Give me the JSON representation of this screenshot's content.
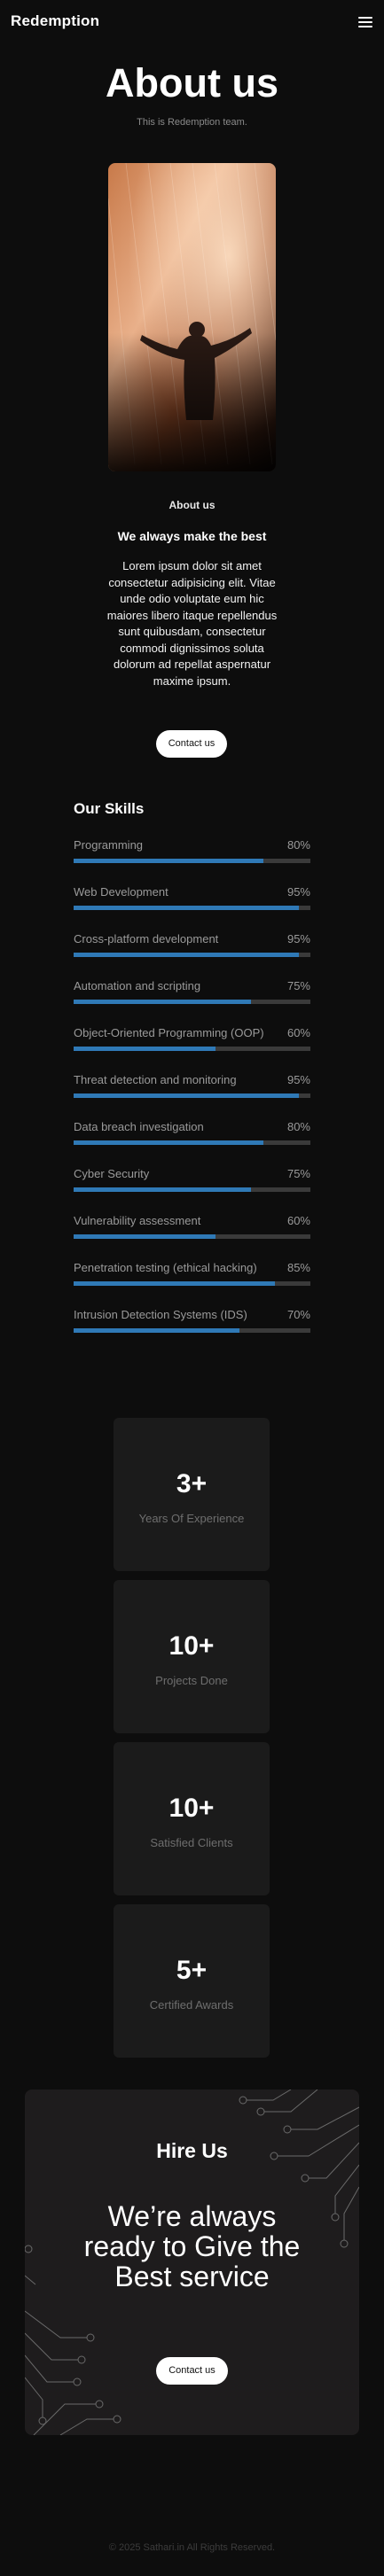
{
  "header": {
    "brand": "Redemption",
    "menu_icon": "hamburger-menu-icon"
  },
  "hero": {
    "title": "About us",
    "subtitle": "This is Redemption team."
  },
  "about": {
    "label": "About us",
    "heading": "We always make the best",
    "body": "Lorem ipsum dolor sit amet consectetur adipisicing elit. Vitae unde odio voluptate eum hic maiores libero itaque repellendus sunt quibusdam, consectetur commodi dignissimos soluta dolorum ad repellat aspernatur maxime ipsum.",
    "button": "Contact us"
  },
  "skills": {
    "title": "Our Skills",
    "bar_color": "#2f79b6",
    "items": [
      {
        "name": "Programming",
        "percent": "80%",
        "value": 80
      },
      {
        "name": "Web Development",
        "percent": "95%",
        "value": 95
      },
      {
        "name": "Cross-platform development",
        "percent": "95%",
        "value": 95
      },
      {
        "name": "Automation and scripting",
        "percent": "75%",
        "value": 75
      },
      {
        "name": "Object-Oriented Programming (OOP)",
        "percent": "60%",
        "value": 60
      },
      {
        "name": "Threat detection and monitoring",
        "percent": "95%",
        "value": 95
      },
      {
        "name": "Data breach investigation",
        "percent": "80%",
        "value": 80
      },
      {
        "name": "Cyber Security",
        "percent": "75%",
        "value": 75
      },
      {
        "name": "Vulnerability assessment",
        "percent": "60%",
        "value": 60
      },
      {
        "name": "Penetration testing (ethical hacking)",
        "percent": "85%",
        "value": 85
      },
      {
        "name": "Intrusion Detection Systems (IDS)",
        "percent": "70%",
        "value": 70
      }
    ]
  },
  "stats": [
    {
      "number": "3+",
      "label": "Years Of Experience"
    },
    {
      "number": "10+",
      "label": "Projects Done"
    },
    {
      "number": "10+",
      "label": "Satisfied Clients"
    },
    {
      "number": "5+",
      "label": "Certified Awards"
    }
  ],
  "hire": {
    "title": "Hire Us",
    "tagline": "We’re always ready to Give the Best service",
    "button": "Contact us"
  },
  "footer": {
    "text": "© 2025 Sathari.in All Rights Reserved."
  }
}
